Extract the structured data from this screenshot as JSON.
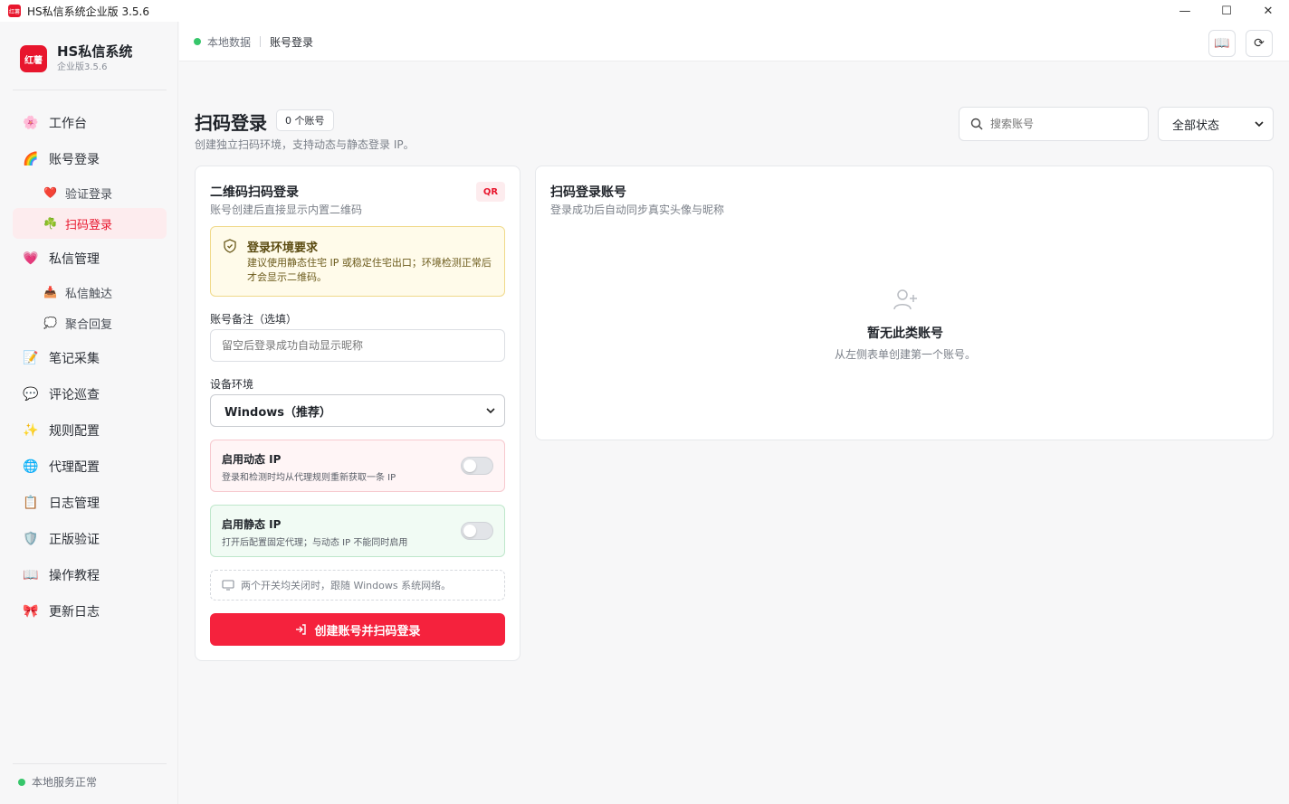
{
  "window": {
    "title": "HS私信系统企业版 3.5.6",
    "app_icon_text": "红薯",
    "minimize": "—",
    "maximize": "☐",
    "close": "✕"
  },
  "sidebar": {
    "brand_logo_text": "红薯",
    "brand_name": "HS私信系统",
    "brand_version": "企业版3.5.6",
    "items": [
      {
        "label": "工作台",
        "icon": "🌸"
      },
      {
        "label": "账号登录",
        "icon": "🌈"
      },
      {
        "label": "验证登录",
        "icon": "❤️"
      },
      {
        "label": "扫码登录",
        "icon": "☘️"
      },
      {
        "label": "私信管理",
        "icon": "💗"
      },
      {
        "label": "私信触达",
        "icon": "📥"
      },
      {
        "label": "聚合回复",
        "icon": "💭"
      },
      {
        "label": "笔记采集",
        "icon": "📝"
      },
      {
        "label": "评论巡查",
        "icon": "💬"
      },
      {
        "label": "规则配置",
        "icon": "✨"
      },
      {
        "label": "代理配置",
        "icon": "🌐"
      },
      {
        "label": "日志管理",
        "icon": "📋"
      },
      {
        "label": "正版验证",
        "icon": "🛡️"
      },
      {
        "label": "操作教程",
        "icon": "📖"
      },
      {
        "label": "更新日志",
        "icon": "🎀"
      }
    ],
    "status": "本地服务正常"
  },
  "topbar": {
    "crumb_root": "本地数据",
    "crumb_current": "账号登录",
    "btn_book_icon": "📖",
    "btn_refresh_icon": "⟳"
  },
  "page": {
    "title": "扫码登录",
    "count": "0 个账号",
    "subtitle": "创建独立扫码环境，支持动态与静态登录 IP。",
    "search_placeholder": "搜索账号",
    "status_filter": "全部状态"
  },
  "left_card": {
    "title": "二维码扫码登录",
    "subtitle": "账号创建后直接显示内置二维码",
    "badge": "QR",
    "warn_title": "登录环境要求",
    "warn_text": "建议使用静态住宅 IP 或稳定住宅出口；环境检测正常后才会显示二维码。",
    "note_label": "账号备注（选填）",
    "note_placeholder": "留空后登录成功自动显示昵称",
    "device_label": "设备环境",
    "device_value": "Windows（推荐）",
    "dynamic_title": "启用动态 IP",
    "dynamic_text": "登录和检测时均从代理规则重新获取一条 IP",
    "static_title": "启用静态 IP",
    "static_text": "打开后配置固定代理；与动态 IP 不能同时启用",
    "hint": "两个开关均关闭时，跟随 Windows 系统网络。",
    "submit": "创建账号并扫码登录"
  },
  "right_card": {
    "title": "扫码登录账号",
    "subtitle": "登录成功后自动同步真实头像与昵称",
    "empty_title": "暂无此类账号",
    "empty_sub": "从左侧表单创建第一个账号。"
  },
  "colors": {
    "brand": "#e8162d",
    "primary_button": "#f5223d",
    "status_ok": "#37c66b"
  }
}
